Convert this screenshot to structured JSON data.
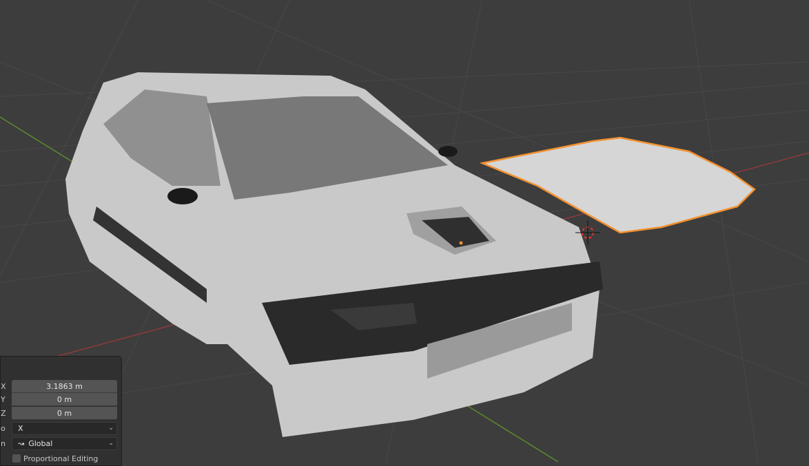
{
  "panel": {
    "x_label": "X",
    "x_value": "3.1863 m",
    "y_label": "Y",
    "y_value": "0 m",
    "z_label": "Z",
    "z_value": "0 m",
    "ortho_label": "o",
    "ortho_value": "X",
    "orient_label": "n",
    "orient_value": "Global",
    "proportional_label": "Proportional Editing"
  },
  "colors": {
    "background": "#3d3d3d",
    "x_axis": "#9b3a3a",
    "y_axis": "#5e8a2e",
    "selection": "#f2902e"
  }
}
